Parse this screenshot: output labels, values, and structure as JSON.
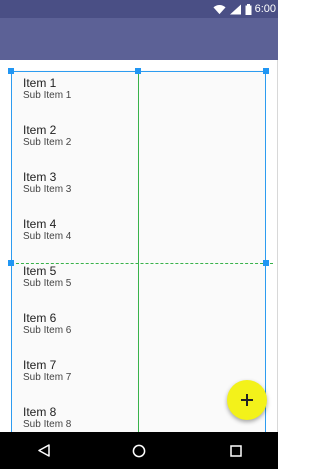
{
  "status_bar": {
    "time": "6:00",
    "icons": [
      "wifi-icon",
      "signal-icon",
      "battery-icon"
    ],
    "background": "#4a4f85"
  },
  "app_bar": {
    "background": "#5c6196"
  },
  "list": {
    "items": [
      {
        "title": "Item 1",
        "subtitle": "Sub Item 1"
      },
      {
        "title": "Item 2",
        "subtitle": "Sub Item 2"
      },
      {
        "title": "Item 3",
        "subtitle": "Sub Item 3"
      },
      {
        "title": "Item 4",
        "subtitle": "Sub Item 4"
      },
      {
        "title": "Item 5",
        "subtitle": "Sub Item 5"
      },
      {
        "title": "Item 6",
        "subtitle": "Sub Item 6"
      },
      {
        "title": "Item 7",
        "subtitle": "Sub Item 7"
      },
      {
        "title": "Item 8",
        "subtitle": "Sub Item 8"
      }
    ]
  },
  "fab": {
    "icon": "plus-icon",
    "color": "#f3f21a"
  },
  "nav_bar": {
    "buttons": [
      "back-icon",
      "home-icon",
      "recents-icon"
    ]
  },
  "overlay": {
    "selection_color": "#2196f3",
    "guide_color": "#38b24a"
  }
}
